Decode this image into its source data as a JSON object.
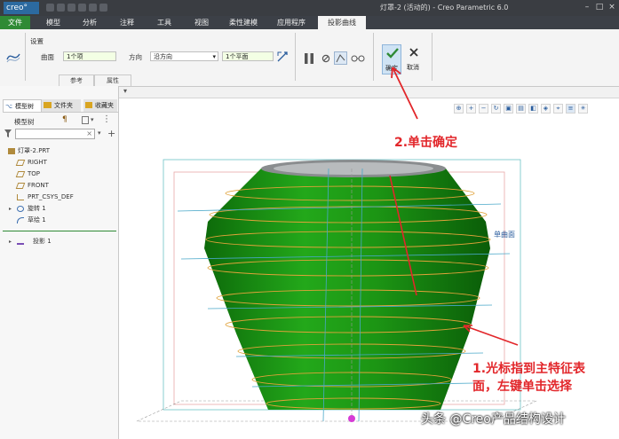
{
  "app": {
    "logo": "creo°",
    "title": "灯罩-2 (活动的) - Creo Parametric 6.0"
  },
  "menu": {
    "file": "文件",
    "items": [
      "模型",
      "分析",
      "注释",
      "工具",
      "视图",
      "柔性建模",
      "应用程序"
    ],
    "active_tab": "投影曲线"
  },
  "ribbon": {
    "group_label": "设置",
    "surface_label": "曲面",
    "surface_value": "1个项",
    "direction_label": "方向",
    "direction_value": "沿方向",
    "plane_value": "1个平面",
    "tab_reference": "参考",
    "tab_properties": "属性",
    "ok_label": "确定",
    "cancel_label": "取消"
  },
  "panel": {
    "tabs": [
      "模型树",
      "文件夹",
      "收藏夹"
    ],
    "tree_title": "模型树",
    "search_placeholder": "",
    "items": [
      {
        "label": "灯罩-2.PRT",
        "icon": "part-icon"
      },
      {
        "label": "RIGHT",
        "icon": "datum-plane-icon"
      },
      {
        "label": "TOP",
        "icon": "datum-plane-icon"
      },
      {
        "label": "FRONT",
        "icon": "datum-plane-icon"
      },
      {
        "label": "PRT_CSYS_DEF",
        "icon": "csys-icon"
      },
      {
        "label": "旋转 1",
        "icon": "revolve-icon"
      },
      {
        "label": "草绘 1",
        "icon": "sketch-icon"
      },
      {
        "label": "投影 1",
        "icon": "project-icon"
      }
    ]
  },
  "graphics": {
    "surface_tag": "单曲面",
    "annotation_confirm": "2.单击确定",
    "annotation_select_line1": "1.光标指到主特征表",
    "annotation_select_line2": "面，左键单击选择",
    "watermark": "头条 @Creo产品结构设计"
  },
  "colors": {
    "accent_green": "#2f8a35",
    "model_green": "#1f9a17",
    "annotation_red": "#e2262a"
  }
}
